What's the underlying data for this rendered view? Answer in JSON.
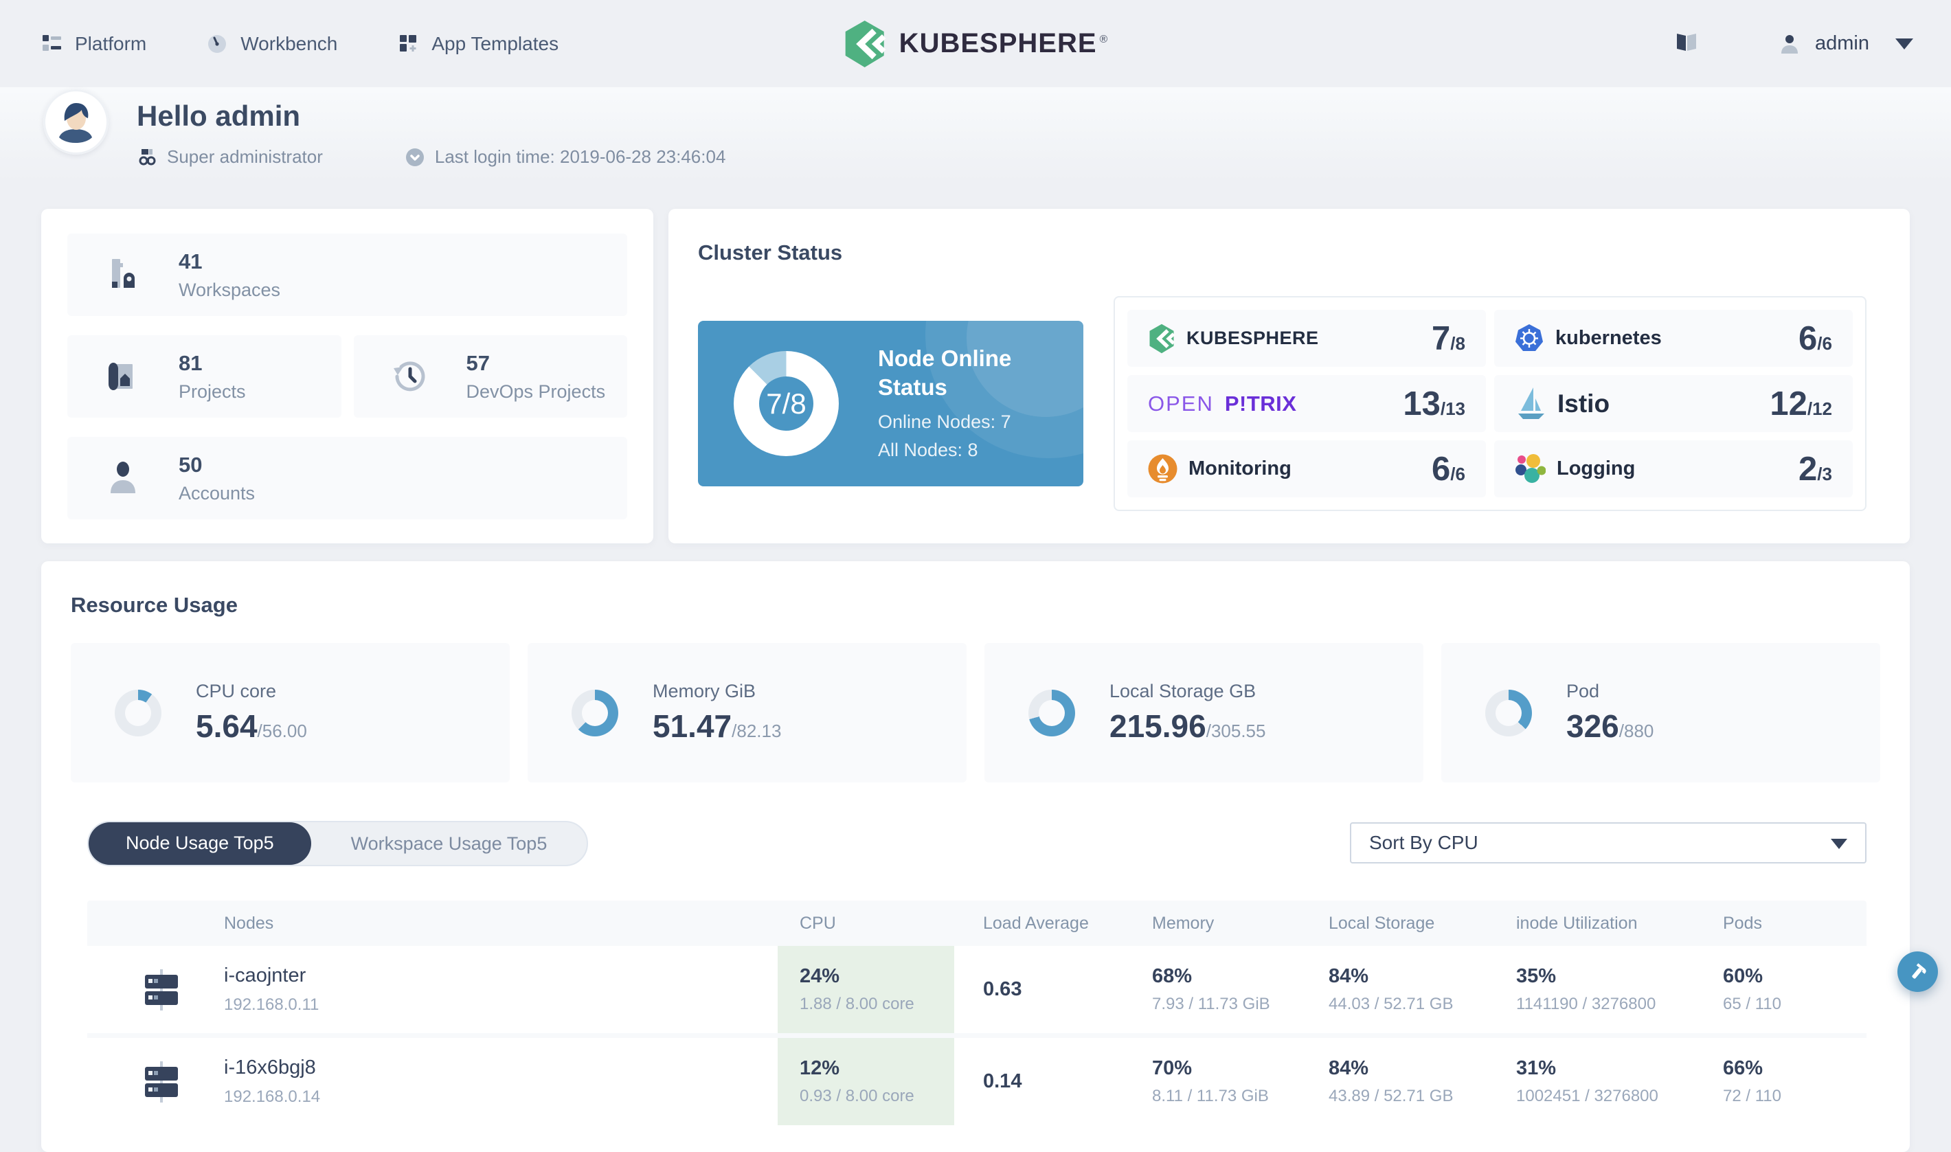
{
  "nav": {
    "items": [
      {
        "label": "Platform"
      },
      {
        "label": "Workbench"
      },
      {
        "label": "App Templates"
      }
    ],
    "brand": "KUBESPHERE",
    "brand_reg": "®",
    "user": "admin"
  },
  "header": {
    "greeting": "Hello admin",
    "role": "Super administrator",
    "last_login": "Last login time: 2019-06-28 23:46:04"
  },
  "stats": {
    "items": [
      {
        "value": "41",
        "label": "Workspaces"
      },
      {
        "value": "81",
        "label": "Projects"
      },
      {
        "value": "57",
        "label": "DevOps Projects"
      },
      {
        "value": "50",
        "label": "Accounts"
      }
    ]
  },
  "cluster": {
    "title": "Cluster Status",
    "node_status": {
      "title": "Node Online Status",
      "ratio": "7/8",
      "online_label": "Online Nodes: 7",
      "all_label": "All Nodes: 8",
      "used": 7,
      "total": 8
    },
    "components": [
      {
        "name": "KUBESPHERE",
        "value": "7",
        "total": "8"
      },
      {
        "name": "kubernetes",
        "value": "6",
        "total": "6"
      },
      {
        "name_light": "OPEN",
        "name_bold": "P!TRIX",
        "value": "13",
        "total": "13"
      },
      {
        "name": "Istio",
        "value": "12",
        "total": "12"
      },
      {
        "name": "Monitoring",
        "value": "6",
        "total": "6"
      },
      {
        "name": "Logging",
        "value": "2",
        "total": "3"
      }
    ]
  },
  "resources": {
    "title": "Resource Usage",
    "gauges": [
      {
        "label": "CPU core",
        "used": 5.64,
        "total": 56,
        "used_display": "5.64",
        "total_display": "56.00"
      },
      {
        "label": "Memory GiB",
        "used": 51.47,
        "total": 82.13,
        "used_display": "51.47",
        "total_display": "82.13"
      },
      {
        "label": "Local Storage GB",
        "used": 215.96,
        "total": 305.55,
        "used_display": "215.96",
        "total_display": "305.55"
      },
      {
        "label": "Pod",
        "used": 326,
        "total": 880,
        "used_display": "326",
        "total_display": "880"
      }
    ],
    "tabs": [
      {
        "label": "Node Usage Top5"
      },
      {
        "label": "Workspace Usage Top5"
      }
    ],
    "sort": {
      "value": "Sort By CPU"
    }
  },
  "table": {
    "columns": [
      "Nodes",
      "CPU",
      "Load Average",
      "Memory",
      "Local Storage",
      "inode Utilization",
      "Pods"
    ],
    "rows": [
      {
        "name": "i-caojnter",
        "ip": "192.168.0.11",
        "cpu_pct": "24%",
        "cpu_detail": "1.88 / 8.00 core",
        "load": "0.63",
        "mem_pct": "68%",
        "mem_detail": "7.93 / 11.73 GiB",
        "storage_pct": "84%",
        "storage_detail": "44.03 / 52.71 GB",
        "inode_pct": "35%",
        "inode_detail": "1141190 / 3276800",
        "pods_pct": "60%",
        "pods_detail": "65 / 110"
      },
      {
        "name": "i-16x6bgj8",
        "ip": "192.168.0.14",
        "cpu_pct": "12%",
        "cpu_detail": "0.93 / 8.00 core",
        "load": "0.14",
        "mem_pct": "70%",
        "mem_detail": "8.11 / 11.73 GiB",
        "storage_pct": "84%",
        "storage_detail": "43.89 / 52.71 GB",
        "inode_pct": "31%",
        "inode_detail": "1002451 / 3276800",
        "pods_pct": "66%",
        "pods_detail": "72 / 110"
      }
    ]
  },
  "colors": {
    "accent_blue": "#4a96c4",
    "donut_blue": "#549dc9",
    "navy": "#36435c",
    "green_cell": "#e7f1e7",
    "brand_green": "#4fb181",
    "background": "#eef0f4"
  }
}
